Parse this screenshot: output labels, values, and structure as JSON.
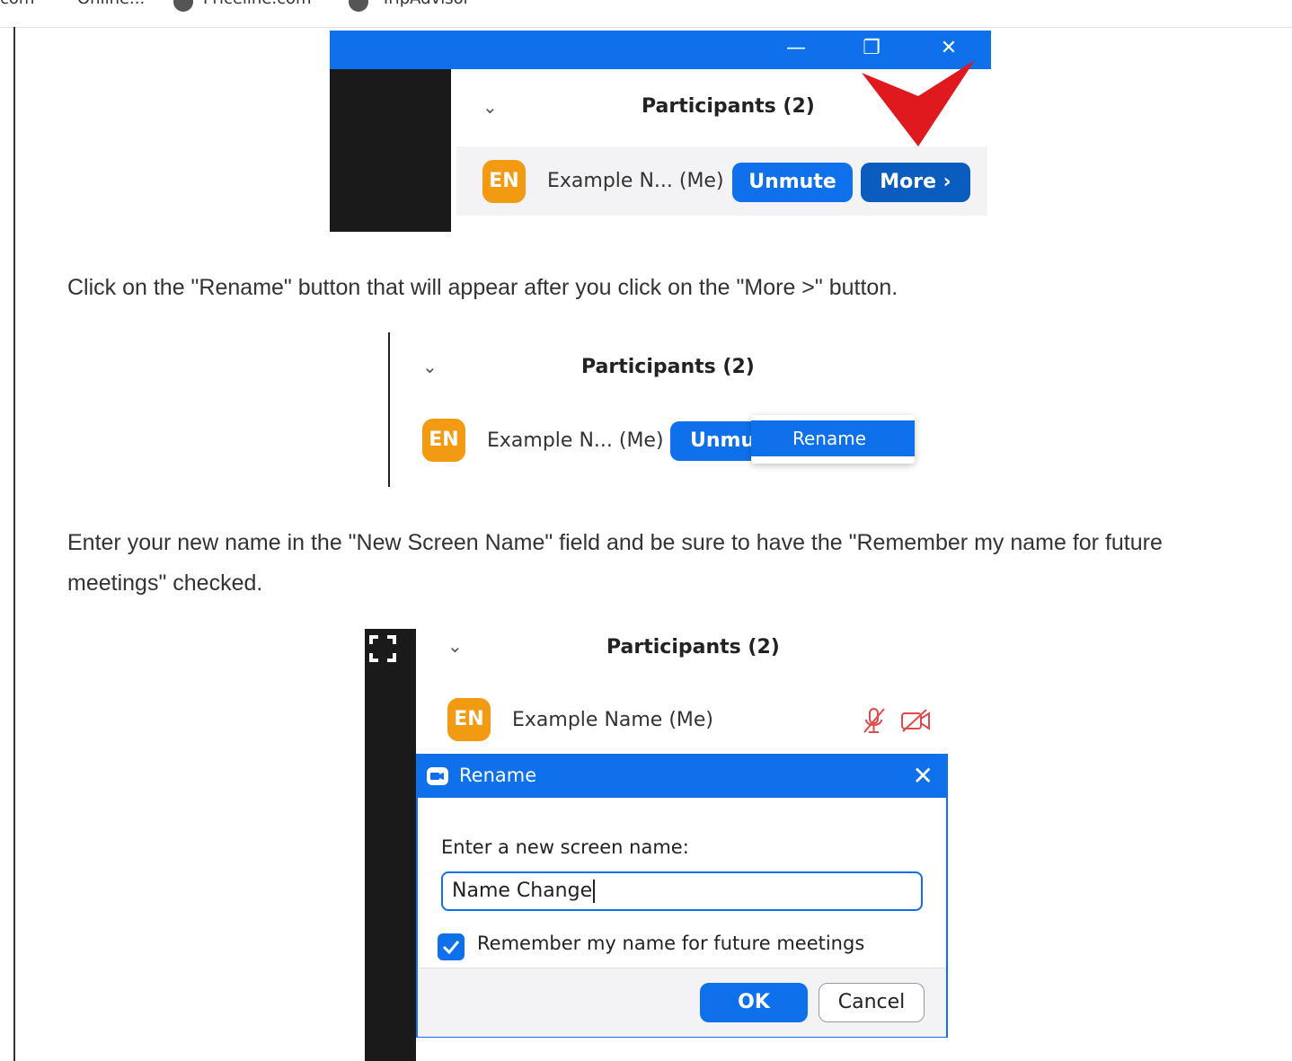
{
  "browser": {
    "bookmarks": [
      "com",
      "Online...",
      "Priceline.com",
      "TripAdvisor"
    ]
  },
  "step1": {
    "participants_title": "Participants (2)",
    "avatar_initials": "EN",
    "participant_name": "Example N... (Me)",
    "unmute_label": "Unmute",
    "more_label": "More ›",
    "minimize_glyph": "—",
    "restore_glyph": "❐",
    "close_glyph": "✕"
  },
  "instruction1": "Click on the \"Rename\" button that will appear after you click on the \"More >\" button.",
  "step2": {
    "participants_title": "Participants (2)",
    "avatar_initials": "EN",
    "participant_name": "Example N... (Me)",
    "unmute_partial": "Unmu",
    "menu_rename": "Rename"
  },
  "instruction2": "Enter your new name in the \"New Screen Name\" field and be sure to have the \"Remember my name for future meetings\" checked.",
  "step3": {
    "participants_title": "Participants (2)",
    "avatar_initials": "EN",
    "participant_name": "Example Name (Me)",
    "dialog": {
      "title": "Rename",
      "close_glyph": "✕",
      "label": "Enter a new screen name:",
      "input_value": "Name Change",
      "remember_checked": true,
      "remember_label": "Remember my name for future meetings",
      "ok_label": "OK",
      "cancel_label": "Cancel"
    }
  },
  "colors": {
    "zoom_blue": "#0e71eb",
    "avatar_orange": "#f29a12",
    "arrow_red": "#e0191f",
    "muted_red": "#e04a4a"
  }
}
